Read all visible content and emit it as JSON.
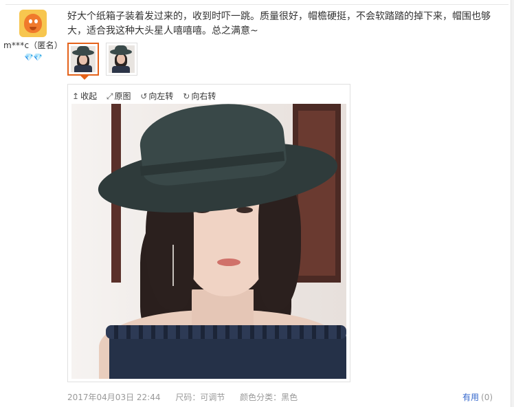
{
  "user": {
    "name": "m***c（匿名）",
    "badge": "💎💎"
  },
  "comment": {
    "text": "好大个纸箱子装着发过来的，收到时吓一跳。质量很好，帽檐硬挺，不会软踏踏的掉下来，帽围也够大，适合我这种大头星人嘻嘻嘻。总之满意~"
  },
  "viewer": {
    "tools": [
      {
        "icon": "↥",
        "label": "收起"
      },
      {
        "icon": "⤢",
        "label": "原图"
      },
      {
        "icon": "↺",
        "label": "向左转"
      },
      {
        "icon": "↻",
        "label": "向右转"
      }
    ]
  },
  "footer": {
    "date": "2017年04月03日 22:44",
    "size": "尺码：可调节",
    "color": "颜色分类：黑色"
  },
  "useful": {
    "label": "有用",
    "count": "(0)"
  },
  "colors": {
    "accent": "#e4621a",
    "link": "#3366cc",
    "muted": "#999999"
  }
}
